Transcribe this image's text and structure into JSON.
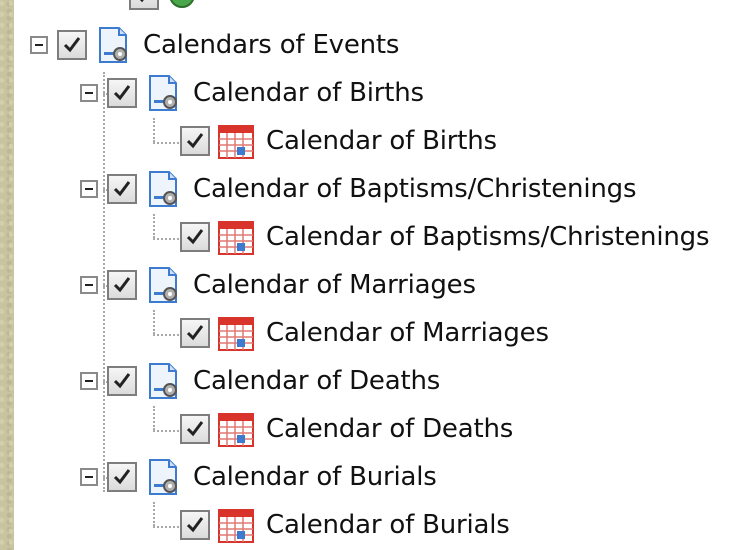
{
  "tree": {
    "root": {
      "label": "Calendars of Events",
      "checked": true,
      "expanded": true,
      "icon": "report-document-icon"
    },
    "groups": [
      {
        "label": "Calendar of Births",
        "checked": true,
        "icon": "report-document-icon",
        "child": {
          "label": "Calendar of Births",
          "checked": true,
          "icon": "calendar-icon"
        }
      },
      {
        "label": "Calendar of Baptisms/Christenings",
        "checked": true,
        "icon": "report-document-icon",
        "child": {
          "label": "Calendar of Baptisms/Christenings",
          "checked": true,
          "icon": "calendar-icon"
        }
      },
      {
        "label": "Calendar of Marriages",
        "checked": true,
        "icon": "report-document-icon",
        "child": {
          "label": "Calendar of Marriages",
          "checked": true,
          "icon": "calendar-icon"
        }
      },
      {
        "label": "Calendar of Deaths",
        "checked": true,
        "icon": "report-document-icon",
        "child": {
          "label": "Calendar of Deaths",
          "checked": true,
          "icon": "calendar-icon"
        }
      },
      {
        "label": "Calendar of Burials",
        "checked": true,
        "icon": "report-document-icon",
        "child": {
          "label": "Calendar of Burials",
          "checked": true,
          "icon": "calendar-icon"
        }
      }
    ]
  },
  "colors": {
    "calendar_red": "#d9342b",
    "doc_blue": "#3d7bd1",
    "check_green": "#1e1e1e"
  }
}
